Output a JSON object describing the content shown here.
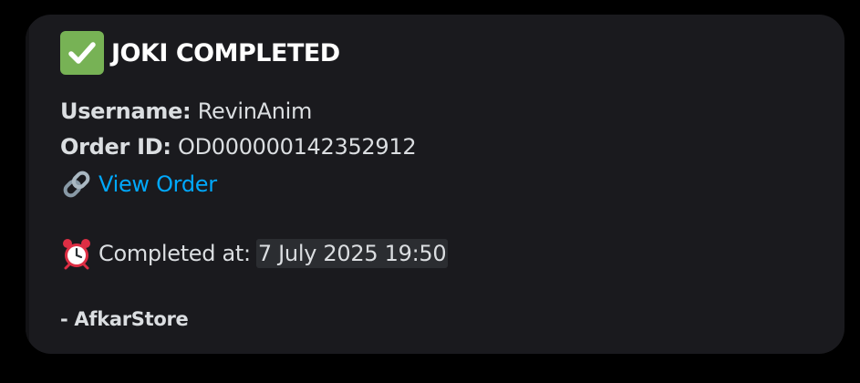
{
  "embed": {
    "title": "JOKI COMPLETED",
    "title_icon": "check-mark-button-icon",
    "username_label": "Username:",
    "username_value": "RevinAnim",
    "order_id_label": "Order ID:",
    "order_id_value": "OD000000142352912",
    "link_icon": "link-icon",
    "view_order_label": "View Order",
    "alarm_icon": "alarm-clock-icon",
    "completed_label": "Completed at:",
    "completed_value": "7 July 2025 19:50",
    "footer": "- AfkarStore"
  },
  "colors": {
    "background": "#000000",
    "embed_background": "#1a1a1e",
    "link": "#00a8fc",
    "text": "#dbdee1",
    "check_green": "#77b255",
    "alarm_red": "#dd2e44"
  }
}
